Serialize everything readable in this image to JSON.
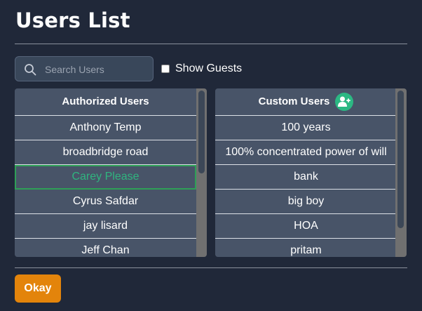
{
  "page": {
    "title": "Users List"
  },
  "search": {
    "placeholder": "Search Users",
    "value": ""
  },
  "show_guests": {
    "label": "Show Guests",
    "checked": false
  },
  "authorized_users": {
    "header": "Authorized Users",
    "items": [
      "Anthony Temp",
      "broadbridge road",
      "Carey Please",
      "Cyrus Safdar",
      "jay lisard",
      "Jeff Chan"
    ],
    "selected_index": 2
  },
  "custom_users": {
    "header": "Custom Users",
    "add_icon": "add-user-icon",
    "items": [
      "100 years",
      "100% concentrated power of will",
      "bank",
      "big boy",
      "HOA",
      "pritam"
    ]
  },
  "actions": {
    "okay_label": "Okay"
  },
  "colors": {
    "background": "#202839",
    "panel": "#485468",
    "selected_text": "#2fb57f",
    "accent_add": "#2cb883",
    "okay_button": "#e3840b"
  }
}
